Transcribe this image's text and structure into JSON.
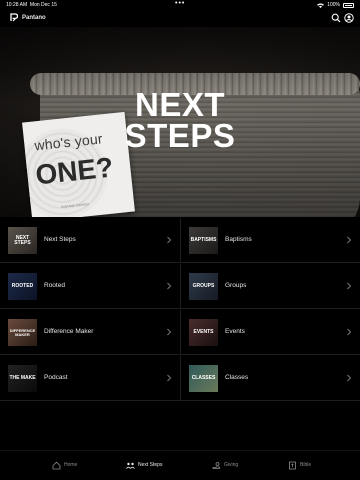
{
  "status": {
    "time": "10:28 AM",
    "date": "Mon Dec 15",
    "battery": "100%"
  },
  "header": {
    "app_name": "Pantano"
  },
  "hero": {
    "title_line1": "NEXT",
    "title_line2": "STEPS",
    "card_line1": "who's your",
    "card_line2": "ONE?",
    "card_footer": "PANTANO CHURCH"
  },
  "menu": {
    "items": [
      {
        "label": "Next Steps",
        "thumb": "NEXT STEPS"
      },
      {
        "label": "Baptisms",
        "thumb": "BAPTISMS"
      },
      {
        "label": "Rooted",
        "thumb": "ROOTED"
      },
      {
        "label": "Groups",
        "thumb": "GROUPS"
      },
      {
        "label": "Difference Maker",
        "thumb": "DIFFERENCE MAKER"
      },
      {
        "label": "Events",
        "thumb": "EVENTS"
      },
      {
        "label": "Podcast",
        "thumb": "THE MAKE"
      },
      {
        "label": "Classes",
        "thumb": "CLASSES"
      }
    ]
  },
  "tabs": [
    {
      "label": "Home",
      "icon": "home-icon"
    },
    {
      "label": "Next Steps",
      "icon": "people-icon"
    },
    {
      "label": "Giving",
      "icon": "giving-icon"
    },
    {
      "label": "Bible",
      "icon": "bible-icon"
    }
  ],
  "colors": {
    "background": "#000000",
    "divider": "#1e1e1e",
    "text": "#e6e6e6",
    "muted": "#8c8c8c"
  }
}
